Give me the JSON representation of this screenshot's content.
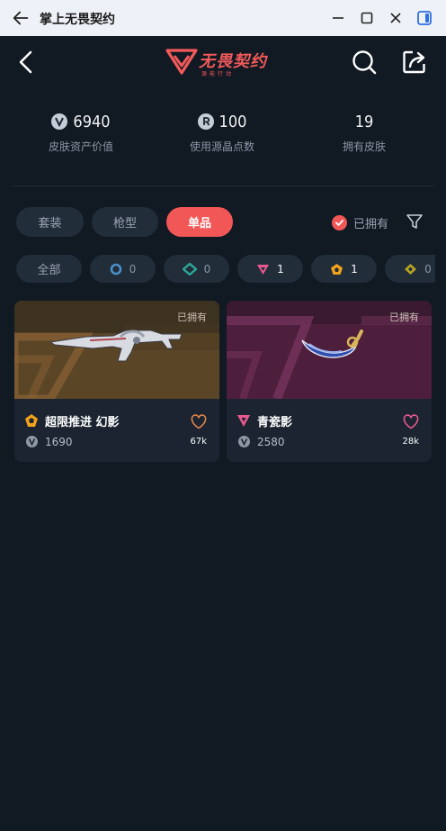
{
  "window": {
    "title": "掌上无畏契约"
  },
  "header": {
    "brand": "无畏契约",
    "brand_sub": "源能行动"
  },
  "stats": [
    {
      "value": "6940",
      "label": "皮肤资产价值"
    },
    {
      "value": "100",
      "label": "使用源晶点数"
    },
    {
      "value": "19",
      "label": "拥有皮肤"
    }
  ],
  "tabs": [
    "套装",
    "枪型",
    "单品"
  ],
  "active_tab": "单品",
  "owned_filter": {
    "label": "已拥有",
    "checked": true
  },
  "tier_chips": [
    {
      "label": "全部"
    },
    {
      "tier": "select",
      "color": "#4a90c8",
      "count": "0"
    },
    {
      "tier": "deluxe",
      "color": "#2aa89a",
      "count": "0"
    },
    {
      "tier": "premium",
      "color": "#e85a8e",
      "count": "1"
    },
    {
      "tier": "exclusive",
      "color": "#f0a21b",
      "count": "1"
    },
    {
      "tier": "ultra",
      "color": "#b8a424",
      "count": "0"
    }
  ],
  "items": [
    {
      "name": "超限推进 幻影",
      "owned_label": "已拥有",
      "price": "1690",
      "likes": "67k",
      "tier_color": "#f0a21b",
      "heart_color": "#e0864a"
    },
    {
      "name": "青瓷影",
      "owned_label": "已拥有",
      "price": "2580",
      "likes": "28k",
      "tier_color": "#e85a8e",
      "heart_color": "#e85a8e"
    }
  ],
  "colors": {
    "accent": "#f25757",
    "background": "#111923",
    "card": "#1b2430"
  },
  "icons": [
    "arrow-left-icon",
    "minimize-icon",
    "maximize-icon",
    "close-icon",
    "sidebar-icon",
    "chevron-left-icon",
    "search-icon",
    "share-icon",
    "filter-icon",
    "heart-icon",
    "check-icon"
  ]
}
